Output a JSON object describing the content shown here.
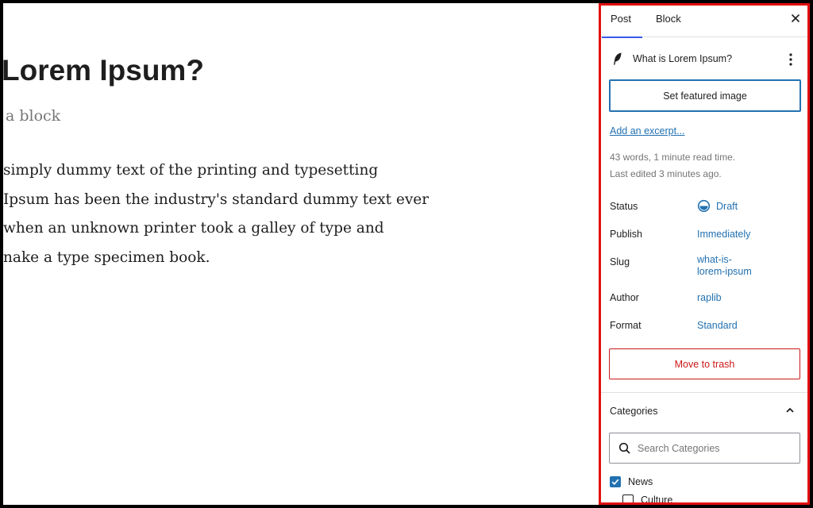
{
  "editor": {
    "title": "Lorem Ipsum?",
    "block_hint": "a block",
    "paragraph_lines": [
      "simply dummy text of the printing and typesetting",
      "Ipsum has been the industry's standard dummy text ever",
      "when an unknown printer took a galley of type and",
      "nake a type specimen book."
    ]
  },
  "sidebar": {
    "tabs": [
      "Post",
      "Block"
    ],
    "active_tab": "Post",
    "close_icon": "close-icon",
    "post_title": "What is Lorem Ipsum?",
    "featured_image_label": "Set featured image",
    "excerpt_link": "Add an excerpt...",
    "stats_words": "43 words, 1 minute read time.",
    "stats_edited": "Last edited 3 minutes ago.",
    "rows": {
      "status": {
        "label": "Status",
        "value": "Draft",
        "icon": "draft-icon"
      },
      "publish": {
        "label": "Publish",
        "value": "Immediately"
      },
      "slug": {
        "label": "Slug",
        "value_line1": "what-is-",
        "value_line2": "lorem-ipsum"
      },
      "author": {
        "label": "Author",
        "value": "raplib"
      },
      "format": {
        "label": "Format",
        "value": "Standard"
      }
    },
    "trash_label": "Move to trash",
    "categories": {
      "heading": "Categories",
      "expanded": true,
      "search_placeholder": "Search Categories",
      "items": [
        {
          "label": "News",
          "checked": true
        },
        {
          "label": "Culture",
          "checked": false
        }
      ]
    }
  },
  "colors": {
    "accent": "#2271b1",
    "tab_indicator": "#3858e9",
    "danger": "#cc1818",
    "highlight_border": "#e31010"
  }
}
